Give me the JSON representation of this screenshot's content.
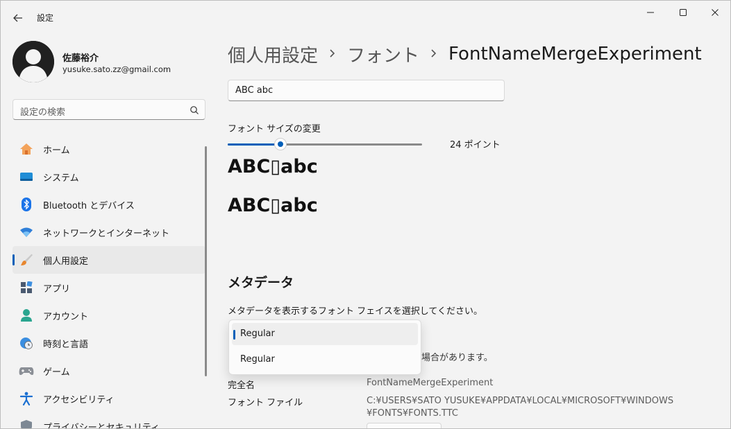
{
  "app": {
    "title": "設定"
  },
  "window_controls": {
    "minimize": "—",
    "maximize": "☐",
    "close": "✕"
  },
  "user": {
    "name": "佐藤裕介",
    "email": "yusuke.sato.zz@gmail.com"
  },
  "search": {
    "placeholder": "設定の検索"
  },
  "nav": {
    "items": [
      {
        "label": "ホーム",
        "icon": "home-icon"
      },
      {
        "label": "システム",
        "icon": "system-icon"
      },
      {
        "label": "Bluetooth とデバイス",
        "icon": "bluetooth-icon"
      },
      {
        "label": "ネットワークとインターネット",
        "icon": "wifi-icon"
      },
      {
        "label": "個人用設定",
        "icon": "brush-icon",
        "active": true
      },
      {
        "label": "アプリ",
        "icon": "apps-icon"
      },
      {
        "label": "アカウント",
        "icon": "account-icon"
      },
      {
        "label": "時刻と言語",
        "icon": "time-language-icon"
      },
      {
        "label": "ゲーム",
        "icon": "gamepad-icon"
      },
      {
        "label": "アクセシビリティ",
        "icon": "accessibility-icon"
      },
      {
        "label": "プライバシーとセキュリティ",
        "icon": "shield-icon"
      }
    ]
  },
  "breadcrumb": {
    "part1": "個人用設定",
    "part2": "フォント",
    "current": "FontNameMergeExperiment"
  },
  "preview": {
    "text": "ABC abc"
  },
  "font_size": {
    "label": "フォント サイズの変更",
    "value_text": "24 ポイント",
    "fraction": 0.27
  },
  "samples": {
    "sample1": "ABC▯abc",
    "sample2": "ABC▯abc"
  },
  "metadata": {
    "heading": "メタデータ",
    "description": "メタデータを表示するフォント フェイスを選択してください。",
    "partial_text": "場合があります。",
    "dropdown_options": [
      "Regular",
      "Regular"
    ],
    "full_name_label": "完全名",
    "full_name_value": "FontNameMergeExperiment",
    "font_file_label": "フォント ファイル",
    "font_file_line1": "C:¥USERS¥SATO YUSUKE¥APPDATA¥LOCAL¥MICROSOFT¥WINDOWS",
    "font_file_line2": "¥FONTS¥FONTS.TTC"
  },
  "colors": {
    "accent": "#005fb8",
    "background": "#f3f3f3"
  }
}
